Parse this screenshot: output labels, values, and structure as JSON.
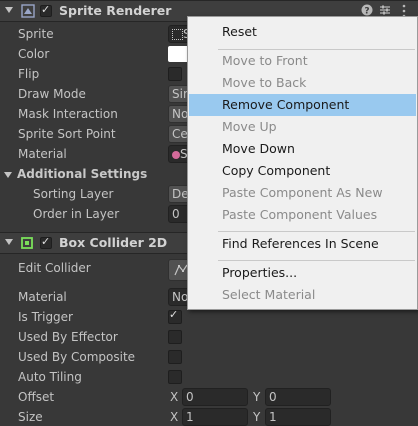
{
  "sprite_renderer": {
    "title": "Sprite Renderer",
    "fields": [
      {
        "label": "Sprite",
        "value": "S"
      },
      {
        "label": "Color",
        "value": ""
      },
      {
        "label": "Flip",
        "value": ""
      },
      {
        "label": "Draw Mode",
        "value": "Sin"
      },
      {
        "label": "Mask Interaction",
        "value": "No"
      },
      {
        "label": "Sprite Sort Point",
        "value": "Ce"
      },
      {
        "label": "Material",
        "value": "S"
      }
    ],
    "additional_settings": {
      "title": "Additional Settings",
      "fields": [
        {
          "label": "Sorting Layer",
          "value": "De"
        },
        {
          "label": "Order in Layer",
          "value": "0"
        }
      ]
    }
  },
  "box_collider": {
    "title": "Box Collider 2D",
    "fields": [
      {
        "label": "Edit Collider"
      },
      {
        "label": "Material",
        "value": "No"
      },
      {
        "label": "Is Trigger",
        "checked": true
      },
      {
        "label": "Used By Effector",
        "checked": false
      },
      {
        "label": "Used By Composite",
        "checked": false
      },
      {
        "label": "Auto Tiling",
        "checked": false
      }
    ],
    "offset": {
      "label": "Offset",
      "x_label": "X",
      "x": "0",
      "y_label": "Y",
      "y": "0"
    },
    "size": {
      "label": "Size",
      "x_label": "X",
      "x": "1",
      "y_label": "Y",
      "y": "1"
    }
  },
  "context_menu": {
    "items": [
      {
        "label": "Reset",
        "enabled": true
      },
      {
        "label": "Move to Front",
        "enabled": false
      },
      {
        "label": "Move to Back",
        "enabled": false
      },
      {
        "label": "Remove Component",
        "enabled": true,
        "highlighted": true
      },
      {
        "label": "Move Up",
        "enabled": false
      },
      {
        "label": "Move Down",
        "enabled": true
      },
      {
        "label": "Copy Component",
        "enabled": true
      },
      {
        "label": "Paste Component As New",
        "enabled": false
      },
      {
        "label": "Paste Component Values",
        "enabled": false
      },
      {
        "label": "Find References In Scene",
        "enabled": true
      },
      {
        "label": "Properties...",
        "enabled": true
      },
      {
        "label": "Select Material",
        "enabled": false
      }
    ]
  },
  "colors": {
    "background": "#383838",
    "header": "#3e3e3e",
    "menu_bg": "#f0f0f0",
    "menu_highlight": "#99c9ef",
    "collider_icon": "#7be05a"
  },
  "icons": [
    "sprite-renderer-icon",
    "help-icon",
    "preset-icon",
    "kebab-menu-icon",
    "box-collider-icon",
    "edit-collider-icon"
  ]
}
